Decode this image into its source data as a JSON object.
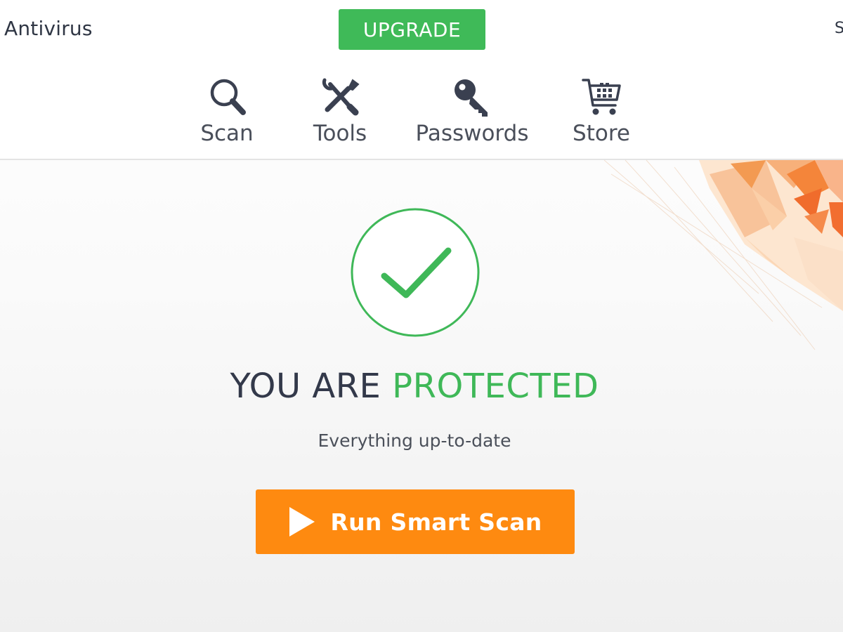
{
  "app": {
    "title": "Antivirus",
    "edge_text": "S"
  },
  "header": {
    "upgrade_label": "UPGRADE"
  },
  "nav": {
    "items": [
      {
        "label": "Scan",
        "icon": "magnifier-icon"
      },
      {
        "label": "Tools",
        "icon": "wrench-screwdriver-icon"
      },
      {
        "label": "Passwords",
        "icon": "key-icon"
      },
      {
        "label": "Store",
        "icon": "shopping-cart-icon"
      }
    ]
  },
  "status": {
    "title_part1": "YOU ARE",
    "title_part2": "PROTECTED",
    "subtitle": "Everything up-to-date",
    "icon": "checkmark-icon"
  },
  "actions": {
    "run_scan_label": "Run Smart Scan",
    "run_scan_icon": "play-icon"
  },
  "colors": {
    "accent_green": "#3fba58",
    "accent_orange": "#fe8a10",
    "text_dark": "#33394a"
  }
}
